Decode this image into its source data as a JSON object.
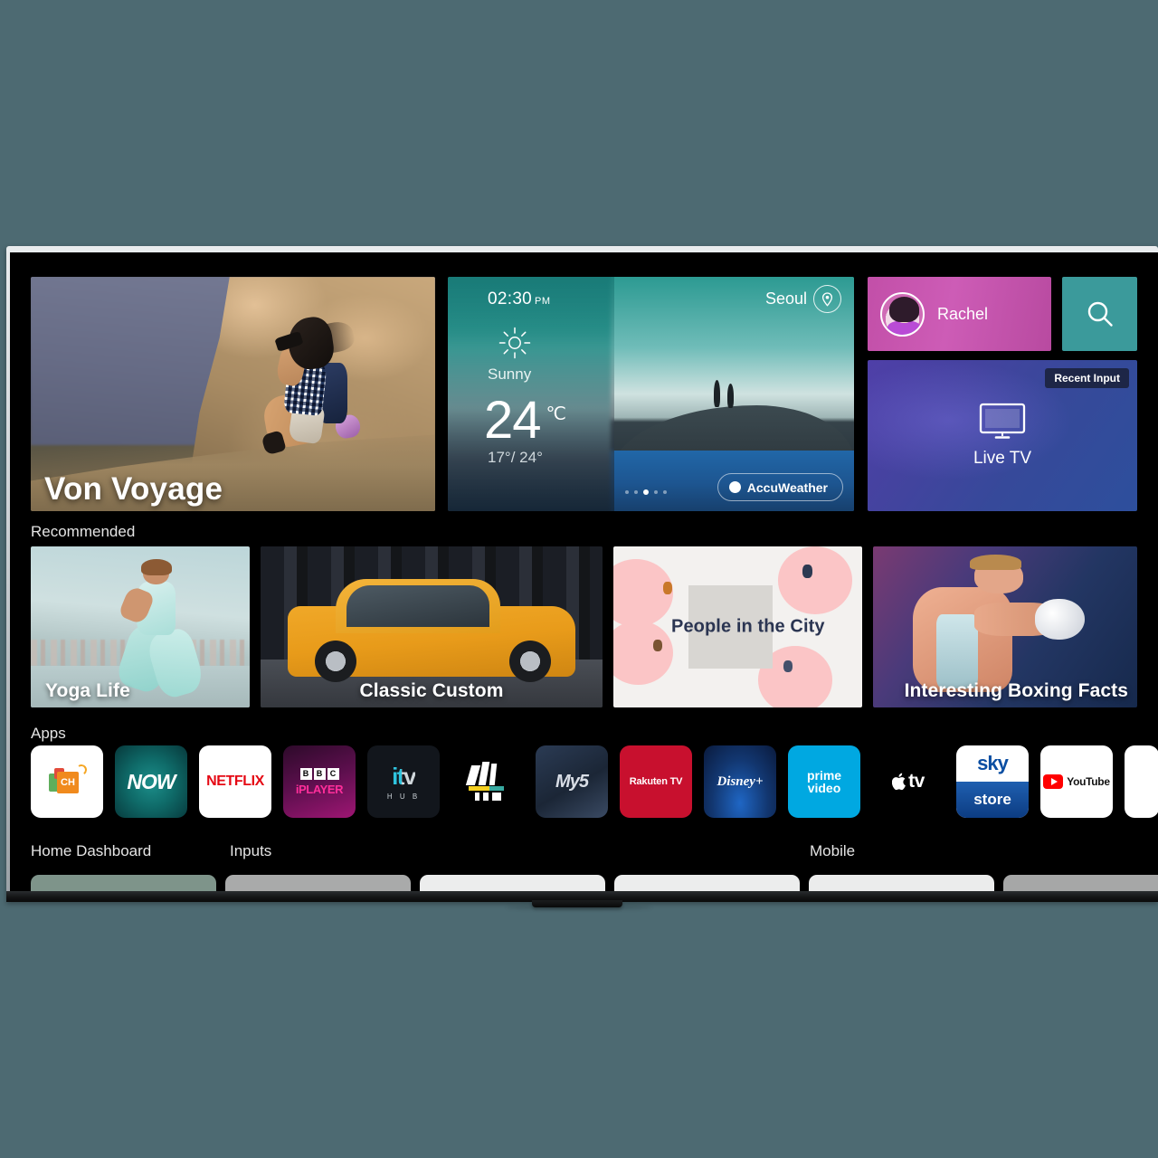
{
  "device": {
    "name": "lg-smart-tv",
    "os": "webOS Home"
  },
  "hero": {
    "title": "Von Voyage"
  },
  "weather": {
    "time": "02:30",
    "ampm": "PM",
    "location": "Seoul",
    "pin_icon": "location-pin-icon",
    "condition": "Sunny",
    "condition_icon": "sun-icon",
    "temperature": "24",
    "unit": "℃",
    "range": "17°/ 24°",
    "provider": "AccuWeather",
    "dots": [
      false,
      false,
      true,
      false,
      false
    ],
    "dot_active_index": 2
  },
  "profile": {
    "name": "Rachel",
    "avatar_icon": "avatar"
  },
  "search": {
    "icon": "search-icon",
    "label": "Search"
  },
  "live_tv": {
    "badge": "Recent Input",
    "label": "Live TV",
    "icon": "tv-monitor-icon"
  },
  "recommended": {
    "title": "Recommended",
    "items": [
      {
        "label": "Yoga Life"
      },
      {
        "label": "Classic Custom"
      },
      {
        "label": "People in the City"
      },
      {
        "label": "Interesting Boxing Facts"
      }
    ]
  },
  "apps": {
    "title": "Apps",
    "items": [
      {
        "name": "Channels",
        "short": "CH"
      },
      {
        "name": "NOW",
        "short": "NOW"
      },
      {
        "name": "Netflix",
        "short": "NETFLIX"
      },
      {
        "name": "BBC iPlayer",
        "short": "iPLAYER",
        "b1": "B",
        "b2": "B",
        "b3": "C"
      },
      {
        "name": "ITV Hub",
        "short": "itv",
        "sub": "H U B"
      },
      {
        "name": "Channel 4",
        "short": "4"
      },
      {
        "name": "My5",
        "short": "My5"
      },
      {
        "name": "Rakuten TV",
        "short": "Rakuten TV"
      },
      {
        "name": "Disney+",
        "short": "Disney+"
      },
      {
        "name": "Prime Video",
        "line1": "prime",
        "line2": "video"
      },
      {
        "name": "Apple TV",
        "short": "tv"
      },
      {
        "name": "Sky Store",
        "line1": "sky",
        "line2": "store"
      },
      {
        "name": "YouTube",
        "short": "YouTube"
      },
      {
        "name": "More",
        "short": ""
      }
    ]
  },
  "bottom_bar": {
    "labels": [
      {
        "text": "Home Dashboard"
      },
      {
        "text": "Inputs"
      },
      {
        "text": "Mobile"
      }
    ],
    "cards": [
      {
        "color": "#7e948a"
      },
      {
        "color": "#a9aaaa"
      },
      {
        "color": "#eceded"
      },
      {
        "color": "#eceded"
      },
      {
        "color": "#ebecec"
      },
      {
        "color": "#a6a7a7"
      }
    ]
  },
  "colors": {
    "background": "#4d6a72",
    "screen": "#000000",
    "profile_accent": "#c24fa8",
    "search_accent": "#3b9a9b",
    "livetv_accent": "#3a459e"
  }
}
